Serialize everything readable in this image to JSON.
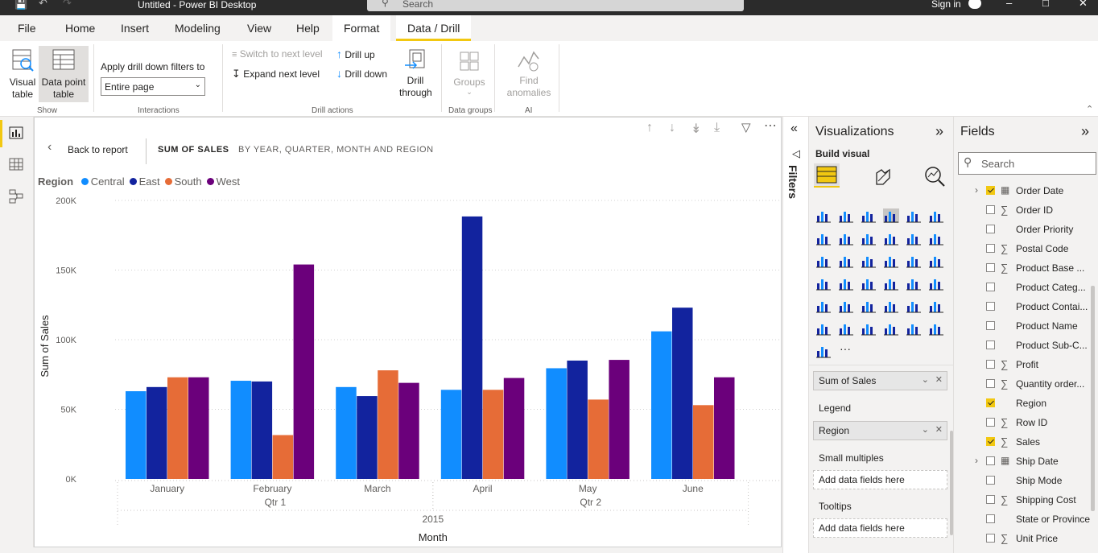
{
  "titlebar": {
    "title": "Untitled - Power BI Desktop",
    "search_placeholder": "Search",
    "signin": "Sign in"
  },
  "menu": {
    "file": "File",
    "home": "Home",
    "insert": "Insert",
    "modeling": "Modeling",
    "view": "View",
    "help": "Help",
    "format": "Format",
    "data_drill": "Data / Drill"
  },
  "ribbon": {
    "visual_table": "Visual table",
    "data_point_table": "Data point table",
    "show_group": "Show",
    "apply_drill_label": "Apply drill down filters to",
    "apply_drill_value": "Entire page",
    "interactions_group": "Interactions",
    "switch_next": "Switch to next level",
    "expand_next": "Expand next level",
    "drill_up": "Drill up",
    "drill_down": "Drill down",
    "drill_through": "Drill through",
    "drill_actions_group": "Drill actions",
    "groups": "Groups",
    "data_groups_group": "Data groups",
    "find_anomalies": "Find anomalies",
    "ai_group": "AI"
  },
  "canvas": {
    "back": "Back to report",
    "measure": "SUM OF SALES",
    "breakdown": "BY YEAR, QUARTER, MONTH AND REGION"
  },
  "chart_data": {
    "type": "bar",
    "legend_title": "Region",
    "categories": [
      "January",
      "February",
      "March",
      "April",
      "May",
      "June"
    ],
    "quarters": [
      {
        "label": "Qtr 1",
        "months": 3
      },
      {
        "label": "Qtr 2",
        "months": 3
      }
    ],
    "year": "2015",
    "xlabel": "Month",
    "ylabel": "Sum of Sales",
    "yticks": [
      "0K",
      "50K",
      "100K",
      "150K",
      "200K"
    ],
    "ylim": [
      0,
      200000
    ],
    "series": [
      {
        "name": "Central",
        "color": "#118dff",
        "values": [
          63000,
          70500,
          66000,
          64000,
          79500,
          106000
        ]
      },
      {
        "name": "East",
        "color": "#12239e",
        "values": [
          66000,
          70000,
          59500,
          188500,
          85000,
          123000
        ]
      },
      {
        "name": "South",
        "color": "#e66c37",
        "values": [
          73000,
          31500,
          78000,
          64000,
          57000,
          53000
        ]
      },
      {
        "name": "West",
        "color": "#6b007b",
        "values": [
          73000,
          154000,
          69000,
          72500,
          85500,
          73000
        ]
      }
    ]
  },
  "filters_label": "Filters",
  "viz": {
    "title": "Visualizations",
    "build_visual": "Build visual",
    "more": "···",
    "value_field": "Sum of Sales",
    "legend_label": "Legend",
    "legend_field": "Region",
    "small_multiples": "Small multiples",
    "add_fields": "Add data fields here",
    "tooltips": "Tooltips"
  },
  "fields": {
    "title": "Fields",
    "search_placeholder": "Search",
    "items": [
      {
        "label": "Order Date",
        "checked": true,
        "sigma": false,
        "table": true
      },
      {
        "label": "Order ID",
        "checked": false,
        "sigma": true
      },
      {
        "label": "Order Priority",
        "checked": false,
        "sigma": false
      },
      {
        "label": "Postal Code",
        "checked": false,
        "sigma": true
      },
      {
        "label": "Product Base ...",
        "checked": false,
        "sigma": true
      },
      {
        "label": "Product Categ...",
        "checked": false,
        "sigma": false
      },
      {
        "label": "Product Contai...",
        "checked": false,
        "sigma": false
      },
      {
        "label": "Product Name",
        "checked": false,
        "sigma": false
      },
      {
        "label": "Product Sub-C...",
        "checked": false,
        "sigma": false
      },
      {
        "label": "Profit",
        "checked": false,
        "sigma": true
      },
      {
        "label": "Quantity order...",
        "checked": false,
        "sigma": true
      },
      {
        "label": "Region",
        "checked": true,
        "sigma": false
      },
      {
        "label": "Row ID",
        "checked": false,
        "sigma": true
      },
      {
        "label": "Sales",
        "checked": true,
        "sigma": true
      },
      {
        "label": "Ship Date",
        "checked": false,
        "sigma": false,
        "table": true
      },
      {
        "label": "Ship Mode",
        "checked": false,
        "sigma": false
      },
      {
        "label": "Shipping Cost",
        "checked": false,
        "sigma": true
      },
      {
        "label": "State or Province",
        "checked": false,
        "sigma": false
      },
      {
        "label": "Unit Price",
        "checked": false,
        "sigma": true
      }
    ]
  }
}
